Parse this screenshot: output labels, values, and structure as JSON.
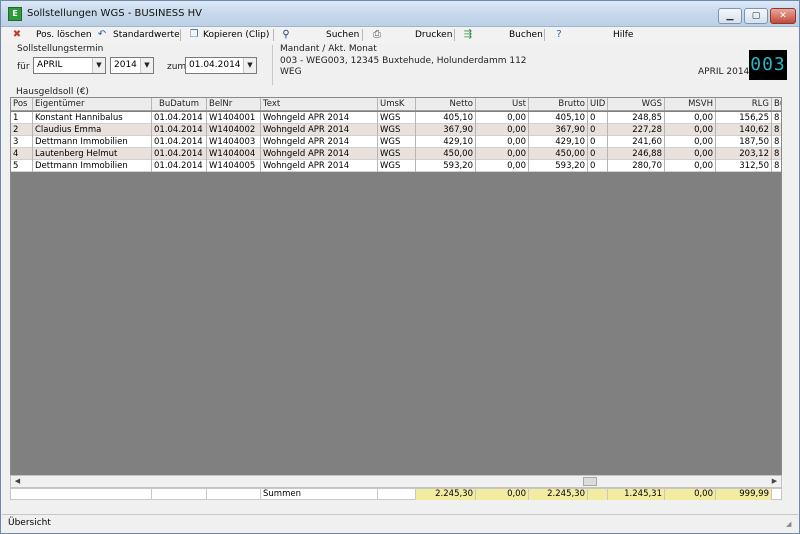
{
  "window": {
    "app_icon": "E",
    "title": "Sollstellungen WGS - BUSINESS HV",
    "min_icon": "minimize-icon",
    "max_icon": "maximize-icon",
    "close_icon": "close-icon"
  },
  "toolbar": {
    "delete_label": "Pos. löschen",
    "defaults_label": "Standardwerte",
    "copy_label": "Kopieren (Clip)",
    "search_label": "Suchen",
    "print_label": "Drucken",
    "book_label": "Buchen",
    "help_label": "Hilfe"
  },
  "header": {
    "termin_group": "Sollstellungstermin",
    "fuer_label": "für",
    "month": "APRIL",
    "year": "2014",
    "zum_label": "zum",
    "date": "01.04.2014",
    "mandant_group": "Mandant / Akt. Monat",
    "mandant_line1": "003 - WEG003, 12345 Buxtehude, Holunderdamm 112",
    "mandant_line2": "WEG",
    "akt_monat": "APRIL 2014",
    "mandant_number": "003"
  },
  "grid": {
    "caption": "Hausgeldsoll (€)",
    "columns": [
      "Pos",
      "Eigentümer",
      "BuDatum",
      "BelNr",
      "Text",
      "UmsK",
      "Netto",
      "Ust",
      "Brutto",
      "UID",
      "WGS",
      "MSVH",
      "RLG",
      "Bu"
    ],
    "rows": [
      [
        "1",
        "Konstant Hannibalus",
        "01.04.2014",
        "W1404001",
        "Wohngeld APR 2014",
        "WGS",
        "405,10",
        "0,00",
        "405,10",
        "0",
        "248,85",
        "0,00",
        "156,25",
        "8"
      ],
      [
        "2",
        "Claudius Emma",
        "01.04.2014",
        "W1404002",
        "Wohngeld APR 2014",
        "WGS",
        "367,90",
        "0,00",
        "367,90",
        "0",
        "227,28",
        "0,00",
        "140,62",
        "8"
      ],
      [
        "3",
        "Dettmann Immobilien",
        "01.04.2014",
        "W1404003",
        "Wohngeld APR 2014",
        "WGS",
        "429,10",
        "0,00",
        "429,10",
        "0",
        "241,60",
        "0,00",
        "187,50",
        "8"
      ],
      [
        "4",
        "Lautenberg Helmut",
        "01.04.2014",
        "W1404004",
        "Wohngeld APR 2014",
        "WGS",
        "450,00",
        "0,00",
        "450,00",
        "0",
        "246,88",
        "0,00",
        "203,12",
        "8"
      ],
      [
        "5",
        "Dettmann Immobilien",
        "01.04.2014",
        "W1404005",
        "Wohngeld APR 2014",
        "WGS",
        "593,20",
        "0,00",
        "593,20",
        "0",
        "280,70",
        "0,00",
        "312,50",
        "8"
      ]
    ]
  },
  "sums": {
    "label": "Summen",
    "netto": "2.245,30",
    "ust": "0,00",
    "brutto": "2.245,30",
    "wgs": "1.245,31",
    "msvh": "0,00",
    "rlg": "999,99"
  },
  "status": {
    "text": "Übersicht"
  }
}
